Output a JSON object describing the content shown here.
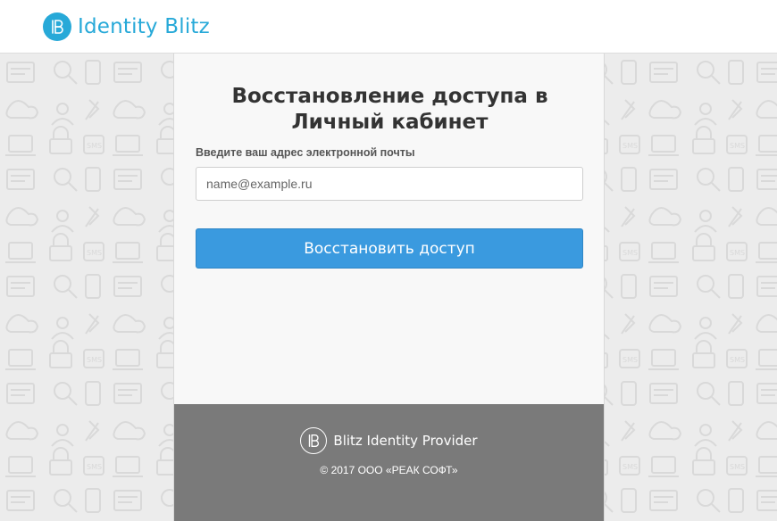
{
  "header": {
    "brand_name": "Identity Blitz",
    "logo_icon": "blitz-b-logo-icon",
    "accent_color": "#27a9d8"
  },
  "form": {
    "title_regular": "Восстановление доступа в ",
    "title_bold": "Личный кабинет",
    "email_label": "Введите ваш адрес электронной почты",
    "email_placeholder": "name@example.ru",
    "email_value": "",
    "submit_label": "Восстановить доступ",
    "button_color": "#3a9adf"
  },
  "footer": {
    "provider_name": "Blitz Identity Provider",
    "copyright": "© 2017 ООО «РЕАК СОФТ»",
    "background_color": "#7a7a7a"
  }
}
